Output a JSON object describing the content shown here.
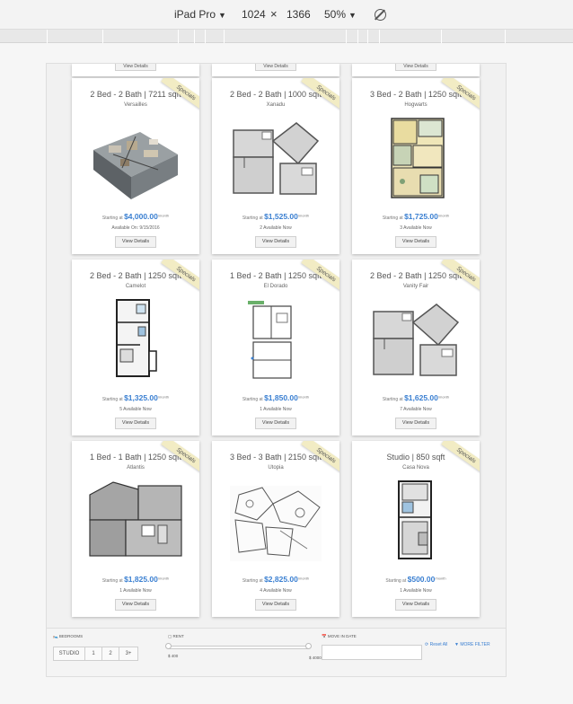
{
  "devtools": {
    "device": "iPad Pro",
    "width": "1024",
    "times": "×",
    "height": "1366",
    "zoom": "50%"
  },
  "top_row": [
    {
      "button": "View Details"
    },
    {
      "button": "View Details"
    },
    {
      "button": "View Details"
    }
  ],
  "listings": [
    {
      "title": "2 Bed - 2 Bath  |  7211 sqft",
      "name": "Versailles",
      "starting": "Starting at",
      "price": "$4,000.00",
      "unit": "/month",
      "availability": "Available On: 9/15/2016",
      "button": "View Details",
      "ribbon": "Specials",
      "plan": "3d"
    },
    {
      "title": "2 Bed - 2 Bath  |  1000 sqft",
      "name": "Xanadu",
      "starting": "Starting at",
      "price": "$1,525.00",
      "unit": "/month",
      "availability": "2 Available Now",
      "button": "View Details",
      "ribbon": "Specials",
      "plan": "gray"
    },
    {
      "title": "3 Bed - 2 Bath  |  1250 sqft",
      "name": "Hogwarts",
      "starting": "Starting at",
      "price": "$1,725.00",
      "unit": "/month",
      "availability": "3 Available Now",
      "button": "View Details",
      "ribbon": "Specials",
      "plan": "color"
    },
    {
      "title": "2 Bed - 2 Bath | 1250 sqft",
      "name": "Camelot",
      "starting": "Starting at",
      "price": "$1,325.00",
      "unit": "/month",
      "availability": "5 Available Now",
      "button": "View Details",
      "ribbon": "Specials",
      "plan": "narrow"
    },
    {
      "title": "1 Bed - 2 Bath  |  1250 sqft",
      "name": "El Dorado",
      "starting": "Starting at",
      "price": "$1,850.00",
      "unit": "/month",
      "availability": "1 Available Now",
      "button": "View Details",
      "ribbon": "Specials",
      "plan": "line"
    },
    {
      "title": "2 Bed - 2 Bath  |  1250 sqft",
      "name": "Vanity Fair",
      "starting": "Starting at",
      "price": "$1,625.00",
      "unit": "/month",
      "availability": "7 Available Now",
      "button": "View Details",
      "ribbon": "Specials",
      "plan": "gray"
    },
    {
      "title": "1 Bed - 1 Bath  |  1250 sqft",
      "name": "Atlantis",
      "starting": "Starting at",
      "price": "$1,825.00",
      "unit": "/month",
      "availability": "1 Available Now",
      "button": "View Details",
      "ribbon": "Specials",
      "plan": "wide"
    },
    {
      "title": "3 Bed - 3 Bath  |  2150 sqft",
      "name": "Utopia",
      "starting": "Starting at",
      "price": "$2,825.00",
      "unit": "/month",
      "availability": "4 Available Now",
      "button": "View Details",
      "ribbon": "Specials",
      "plan": "sketch"
    },
    {
      "title": "Studio  |  850 sqft",
      "name": "Casa Nova",
      "starting": "Starting at",
      "price": "$500.00",
      "unit": "/month",
      "availability": "1 Available Now",
      "button": "View Details",
      "ribbon": "Specials",
      "plan": "narrow2"
    }
  ],
  "filters": {
    "bedrooms_label": "BEDROOMS",
    "bedroom_options": [
      "STUDIO",
      "1",
      "2",
      "3+"
    ],
    "rent_label": "RENT",
    "rent_min": "$ 400",
    "rent_max": "$ 4000",
    "move_in_label": "MOVE IN DATE",
    "move_in_value": "",
    "reset_label": "Reset All",
    "more_filter_label": "MORE FILTER"
  }
}
